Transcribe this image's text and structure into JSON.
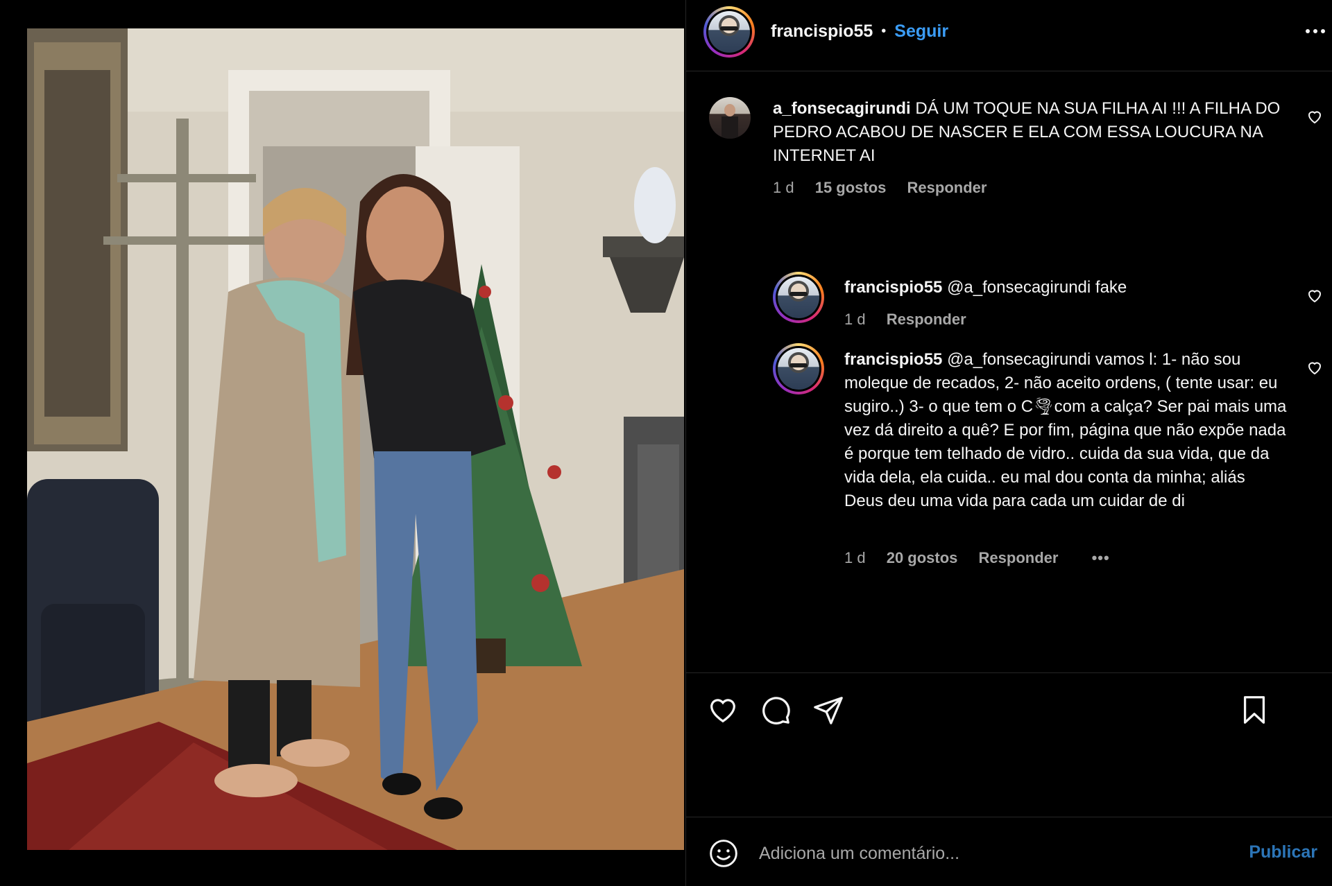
{
  "header": {
    "username": "francispio55",
    "separator": "•",
    "follow_label": "Seguir",
    "more_icon": "more-horizontal-icon"
  },
  "comments": [
    {
      "username": "a_fonsecagirundi",
      "text": "DÁ UM TOQUE NA SUA FILHA AI !!! A FILHA DO PEDRO ACABOU DE NASCER E ELA COM ESSA LOUCURA NA INTERNET AI",
      "time": "1 d",
      "likes": "15 gostos",
      "reply_label": "Responder"
    }
  ],
  "replies": [
    {
      "username": "francispio55",
      "text": "@a_fonsecagirundi fake",
      "time": "1 d",
      "reply_label": "Responder"
    },
    {
      "username": "francispio55",
      "text": "@a_fonsecagirundi vamos l: 1- não sou moleque de recados, 2- não aceito ordens, ( tente usar: eu sugiro..) 3- o que tem o C🌪com a calça? Ser pai mais uma vez dá direito a quê? E por fim, página que não expõe nada é porque tem telhado de vidro.. cuida da sua vida, que da vida dela, ela cuida.. eu mal dou conta da minha; aliás Deus deu uma vida para cada um cuidar de di",
      "time": "1 d",
      "likes": "20 gostos",
      "reply_label": "Responder",
      "more": "•••"
    }
  ],
  "actions": {
    "like_icon": "heart-icon",
    "comment_icon": "comment-icon",
    "share_icon": "send-icon",
    "save_icon": "bookmark-icon"
  },
  "composer": {
    "emoji_icon": "emoji-icon",
    "placeholder": "Adiciona um comentário...",
    "publish_label": "Publicar"
  }
}
